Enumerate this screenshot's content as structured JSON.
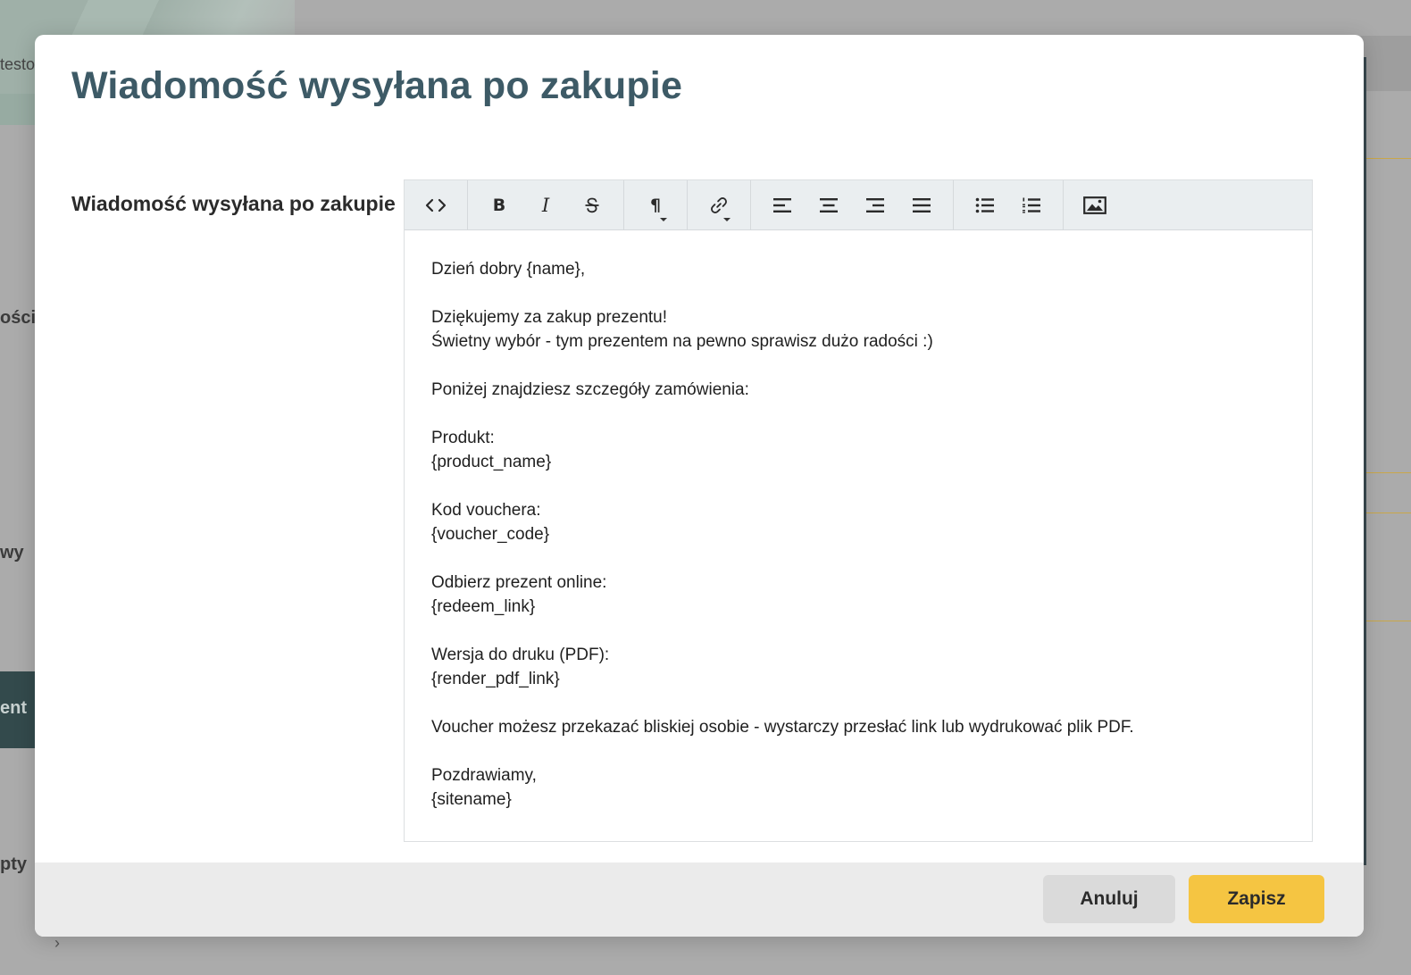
{
  "background": {
    "tab_partial": "testo",
    "side_labels": [
      "ości",
      "wy",
      "ent",
      "pty"
    ],
    "chevron": "›"
  },
  "modal": {
    "title": "Wiadomość wysyłana po zakupie",
    "field_label": "Wiadomość wysyłana po zakupie"
  },
  "toolbar": {
    "icons": [
      "code-view-icon",
      "bold-icon",
      "italic-icon",
      "strikethrough-icon",
      "paragraph-icon",
      "link-icon",
      "align-left-icon",
      "align-center-icon",
      "align-right-icon",
      "align-justify-icon",
      "bullet-list-icon",
      "numbered-list-icon",
      "image-icon"
    ],
    "bold": "B",
    "italic": "I",
    "paragraph": "¶"
  },
  "editor": {
    "lines": [
      "Dzień dobry {name},",
      "",
      "Dziękujemy za zakup prezentu!",
      "Świetny wybór - tym prezentem na pewno sprawisz dużo radości :)",
      "",
      "Poniżej znajdziesz szczegóły zamówienia:",
      "",
      "Produkt:",
      "{product_name}",
      "",
      "Kod vouchera:",
      "{voucher_code}",
      "",
      "Odbierz prezent online:",
      "{redeem_link}",
      "",
      "Wersja do druku (PDF):",
      "{render_pdf_link}",
      "",
      "Voucher możesz przekazać bliskiej osobie - wystarczy przesłać link lub wydrukować plik PDF.",
      "",
      "Pozdrawiamy,",
      "{sitename}"
    ]
  },
  "footer": {
    "cancel_label": "Anuluj",
    "save_label": "Zapisz"
  },
  "colors": {
    "title": "#3d5a66",
    "save_button": "#f5c542",
    "overlay": "#ababab"
  }
}
